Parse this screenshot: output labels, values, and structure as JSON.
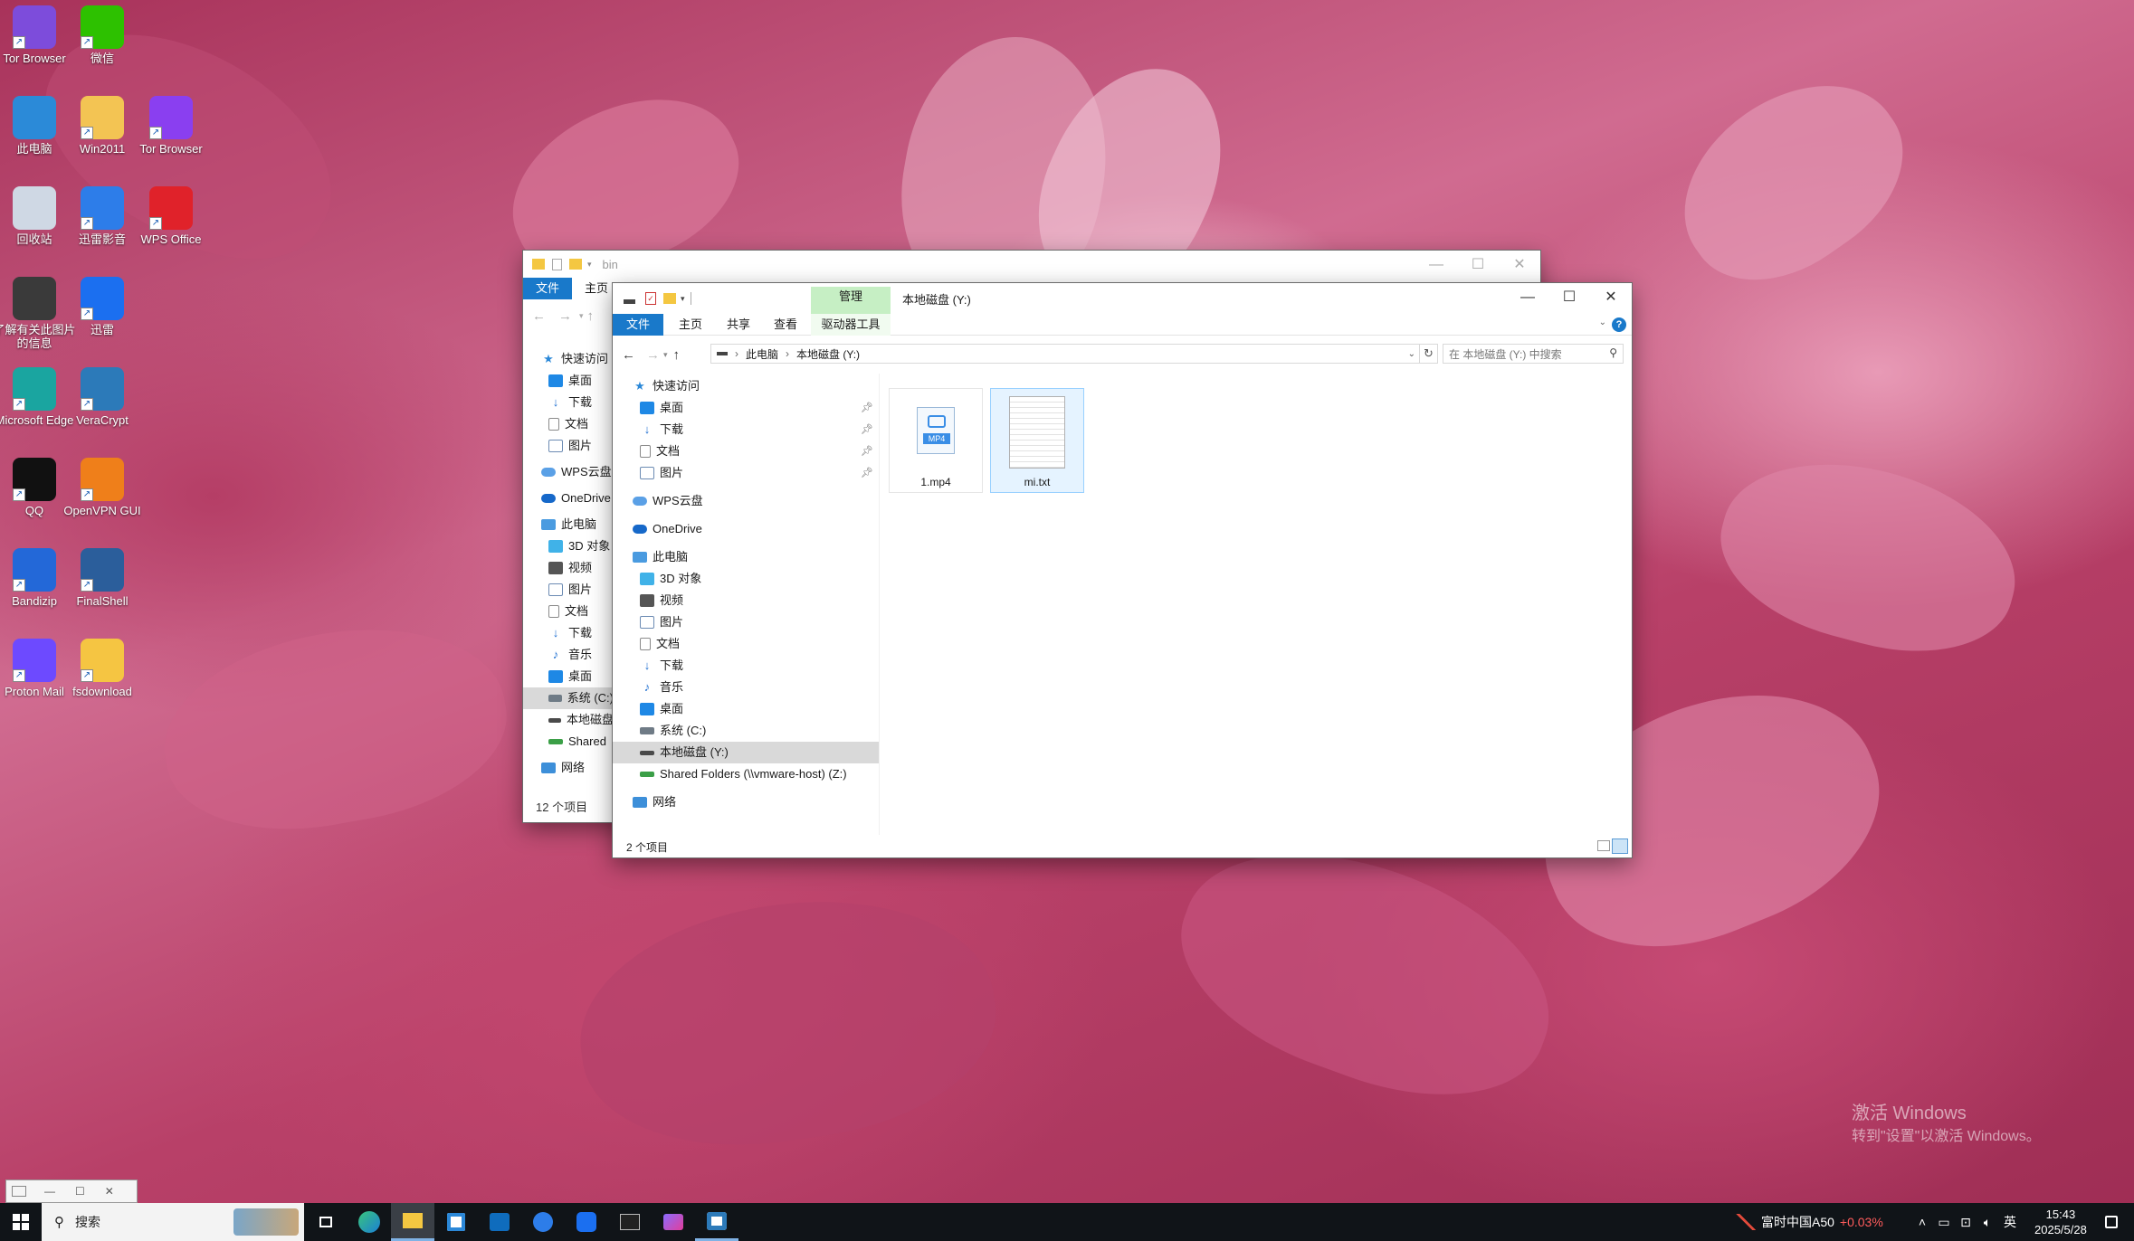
{
  "desktop": {
    "icons": [
      {
        "label": "Tor Browser",
        "color": "#7d4cdb"
      },
      {
        "label": "微信",
        "color": "#2dc100"
      },
      {
        "label": "此电脑",
        "color": "#2b8ad8"
      },
      {
        "label": "Win2011",
        "color": "#f3c453"
      },
      {
        "label": "Tor Browser",
        "color": "#8a3ff0"
      },
      {
        "label": "回收站",
        "color": "#cfd8e4"
      },
      {
        "label": "迅雷影音",
        "color": "#2d7de9"
      },
      {
        "label": "WPS Office",
        "color": "#e0222a"
      },
      {
        "label": "了解有关此图片的信息",
        "color": "#3a3a3a"
      },
      {
        "label": "迅雷",
        "color": "#1b6ff0"
      },
      {
        "label": "Microsoft Edge",
        "color": "#1aa5a0"
      },
      {
        "label": "VeraCrypt",
        "color": "#2c7ab9"
      },
      {
        "label": "QQ",
        "color": "#111111"
      },
      {
        "label": "OpenVPN GUI",
        "color": "#ef7f1a"
      },
      {
        "label": "Bandizip",
        "color": "#2368d8"
      },
      {
        "label": "FinalShell",
        "color": "#2b5e9b"
      },
      {
        "label": "Proton Mail",
        "color": "#6d4aff"
      },
      {
        "label": "fsdownload",
        "color": "#f5c542"
      }
    ],
    "watermark_line1": "激活 Windows",
    "watermark_line2": "转到\"设置\"以激活 Windows。"
  },
  "back_window": {
    "title": "bin",
    "tab_file": "文件",
    "tab_home": "主页",
    "nav": [
      {
        "label": "快速访问",
        "icon": "star-icon",
        "indent": 0
      },
      {
        "label": "桌面",
        "icon": "desktop-folder-icon",
        "indent": 1
      },
      {
        "label": "下载",
        "icon": "download-arrow-icon",
        "indent": 1
      },
      {
        "label": "文档",
        "icon": "document-icon",
        "indent": 1
      },
      {
        "label": "图片",
        "icon": "picture-icon",
        "indent": 1
      },
      {
        "label": "WPS云盘",
        "icon": "cloud-icon",
        "indent": 0
      },
      {
        "label": "OneDrive",
        "icon": "onedrive-icon",
        "indent": 0
      },
      {
        "label": "此电脑",
        "icon": "computer-icon",
        "indent": 0
      },
      {
        "label": "3D 对象",
        "icon": "3d-objects-icon",
        "indent": 1
      },
      {
        "label": "视频",
        "icon": "video-icon",
        "indent": 1
      },
      {
        "label": "图片",
        "icon": "picture-icon",
        "indent": 1
      },
      {
        "label": "文档",
        "icon": "document-icon",
        "indent": 1
      },
      {
        "label": "下载",
        "icon": "download-arrow-icon",
        "indent": 1
      },
      {
        "label": "音乐",
        "icon": "music-icon",
        "indent": 1
      },
      {
        "label": "桌面",
        "icon": "desktop-folder-icon",
        "indent": 1
      },
      {
        "label": "系统 (C:)",
        "icon": "system-drive-icon",
        "indent": 1,
        "selected": true
      },
      {
        "label": "本地磁盘",
        "icon": "drive-icon",
        "indent": 1
      },
      {
        "label": "Shared",
        "icon": "network-drive-icon",
        "indent": 1
      },
      {
        "label": "网络",
        "icon": "network-icon",
        "indent": 0
      }
    ],
    "status": "12 个项目"
  },
  "front_window": {
    "title": "本地磁盘 (Y:)",
    "manage_tab": "管理",
    "drive_tools_tab": "驱动器工具",
    "tabs": [
      "文件",
      "主页",
      "共享",
      "查看"
    ],
    "breadcrumb": [
      "此电脑",
      "本地磁盘 (Y:)"
    ],
    "search_placeholder": "在 本地磁盘 (Y:) 中搜索",
    "nav": [
      {
        "label": "快速访问",
        "icon": "star-icon",
        "indent": 0
      },
      {
        "label": "桌面",
        "icon": "desktop-folder-icon",
        "indent": 1,
        "pinned": true
      },
      {
        "label": "下载",
        "icon": "download-arrow-icon",
        "indent": 1,
        "pinned": true
      },
      {
        "label": "文档",
        "icon": "document-icon",
        "indent": 1,
        "pinned": true
      },
      {
        "label": "图片",
        "icon": "picture-icon",
        "indent": 1,
        "pinned": true
      },
      {
        "label": "WPS云盘",
        "icon": "cloud-icon",
        "indent": 0,
        "gap": true
      },
      {
        "label": "OneDrive",
        "icon": "onedrive-icon",
        "indent": 0,
        "gap": true
      },
      {
        "label": "此电脑",
        "icon": "computer-icon",
        "indent": 0,
        "gap": true
      },
      {
        "label": "3D 对象",
        "icon": "3d-objects-icon",
        "indent": 1
      },
      {
        "label": "视频",
        "icon": "video-icon",
        "indent": 1
      },
      {
        "label": "图片",
        "icon": "picture-icon",
        "indent": 1
      },
      {
        "label": "文档",
        "icon": "document-icon",
        "indent": 1
      },
      {
        "label": "下载",
        "icon": "download-arrow-icon",
        "indent": 1
      },
      {
        "label": "音乐",
        "icon": "music-icon",
        "indent": 1
      },
      {
        "label": "桌面",
        "icon": "desktop-folder-icon",
        "indent": 1
      },
      {
        "label": "系统 (C:)",
        "icon": "system-drive-icon",
        "indent": 1
      },
      {
        "label": "本地磁盘 (Y:)",
        "icon": "drive-icon",
        "indent": 1,
        "selected": true
      },
      {
        "label": "Shared Folders (\\\\vmware-host) (Z:)",
        "icon": "network-drive-icon",
        "indent": 1
      },
      {
        "label": "网络",
        "icon": "network-icon",
        "indent": 0,
        "gap": true
      }
    ],
    "files": [
      {
        "name": "1.mp4",
        "type": "mp4",
        "badge": "MP4"
      },
      {
        "name": "mi.txt",
        "type": "txt",
        "selected": true
      }
    ],
    "status": "2 个项目"
  },
  "mini_window": {
    "close": "✕"
  },
  "taskbar": {
    "search_label": "搜索",
    "stock_name": "富时中国A50",
    "stock_change": "+0.03%",
    "ime": "英",
    "time": "15:43",
    "date": "2025/5/28",
    "accent": "#1979ca"
  }
}
